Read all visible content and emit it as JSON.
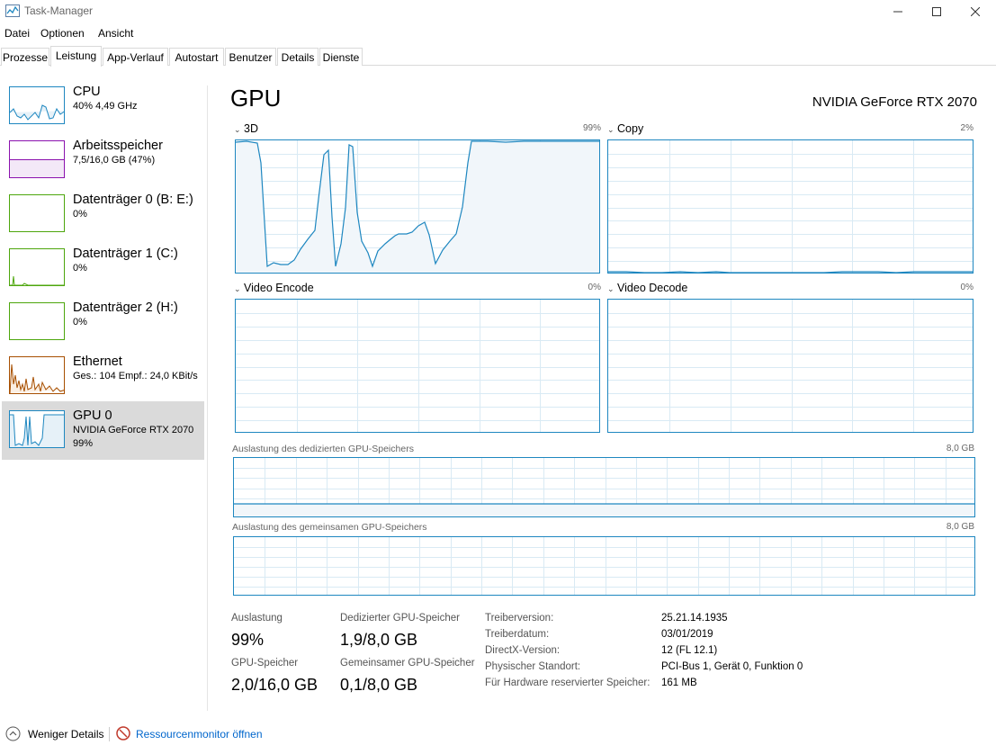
{
  "window": {
    "title": "Task-Manager"
  },
  "menu": [
    "Datei",
    "Optionen",
    "Ansicht"
  ],
  "tabs": [
    "Prozesse",
    "Leistung",
    "App-Verlauf",
    "Autostart",
    "Benutzer",
    "Details",
    "Dienste"
  ],
  "active_tab": "Leistung",
  "sidebar": [
    {
      "name": "CPU",
      "sub": "40% 4,49 GHz",
      "color": "#1e87c0"
    },
    {
      "name": "Arbeitsspeicher",
      "sub": "7,5/16,0 GB (47%)",
      "color": "#8b12ae"
    },
    {
      "name": "Datenträger 0 (B: E:)",
      "sub": "0%",
      "color": "#4da60c"
    },
    {
      "name": "Datenträger 1 (C:)",
      "sub": "0%",
      "color": "#4da60c"
    },
    {
      "name": "Datenträger 2 (H:)",
      "sub": "0%",
      "color": "#4da60c"
    },
    {
      "name": "Ethernet",
      "sub": "Ges.: 104 Empf.: 24,0 KBit/s",
      "color": "#a74f01"
    },
    {
      "name": "GPU 0",
      "sub": "NVIDIA GeForce RTX 2070",
      "sub2": "99%",
      "color": "#1e87c0"
    }
  ],
  "main": {
    "title": "GPU",
    "gpu_name": "NVIDIA GeForce RTX 2070",
    "engines": [
      {
        "label": "3D",
        "value": "99%"
      },
      {
        "label": "Copy",
        "value": "2%"
      },
      {
        "label": "Video Encode",
        "value": "0%"
      },
      {
        "label": "Video Decode",
        "value": "0%"
      }
    ],
    "dedicated_label": "Auslastung des dedizierten GPU-Speichers",
    "dedicated_max": "8,0 GB",
    "shared_label": "Auslastung des gemeinsamen GPU-Speichers",
    "shared_max": "8,0 GB"
  },
  "stats": {
    "util_label": "Auslastung",
    "util_value": "99%",
    "gpumem_label": "GPU-Speicher",
    "gpumem_value": "2,0/16,0 GB",
    "ded_label": "Dedizierter GPU-Speicher",
    "ded_value": "1,9/8,0 GB",
    "shr_label": "Gemeinsamer GPU-Speicher",
    "shr_value": "0,1/8,0 GB"
  },
  "info": [
    {
      "label": "Treiberversion:",
      "value": "25.21.14.1935"
    },
    {
      "label": "Treiberdatum:",
      "value": "03/01/2019"
    },
    {
      "label": "DirectX-Version:",
      "value": "12 (FL 12.1)"
    },
    {
      "label": "Physischer Standort:",
      "value": "PCI-Bus 1, Gerät 0, Funktion 0"
    },
    {
      "label": "Für Hardware reservierter Speicher:",
      "value": "161 MB"
    }
  ],
  "footer": {
    "less_details": "Weniger Details",
    "resmon": "Ressourcenmonitor öffnen"
  },
  "colors": {
    "gpu_line": "#1e87c0",
    "grid": "#d9eaf4",
    "fill": "#f1f6fa",
    "link": "#0066cc"
  }
}
